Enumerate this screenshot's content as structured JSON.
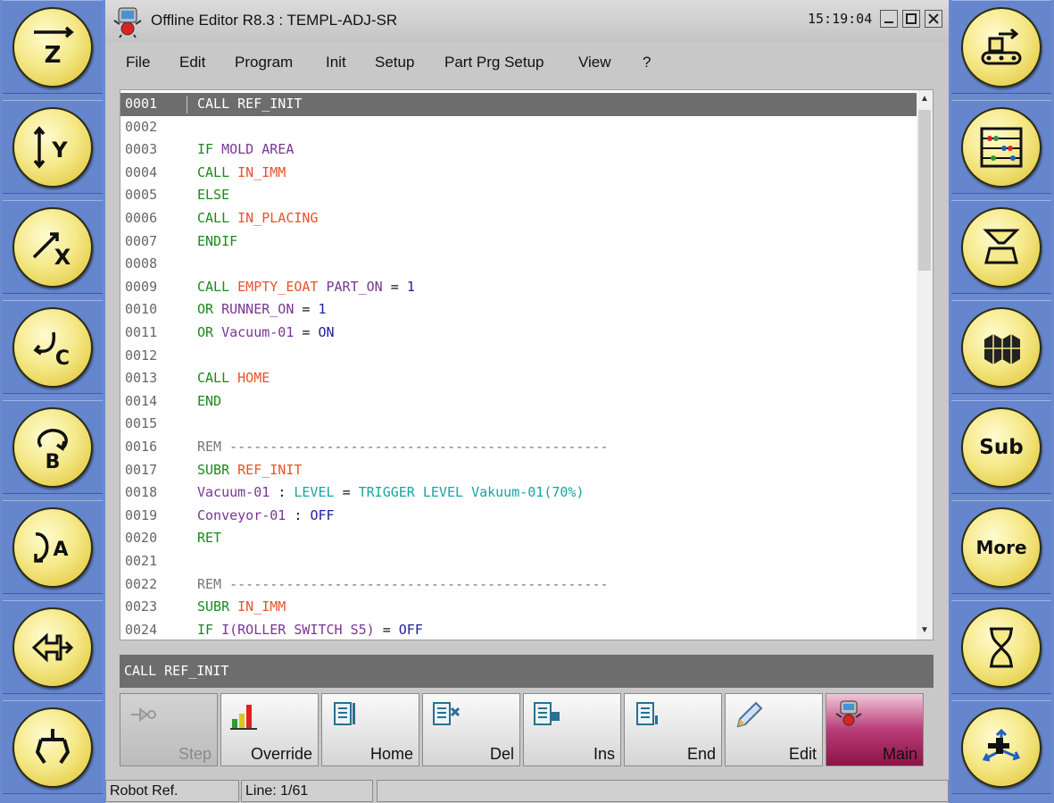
{
  "window": {
    "title": "Offline Editor R8.3 : TEMPL-ADJ-SR",
    "clock": "15:19:04"
  },
  "menu": [
    "File",
    "Edit",
    "Program",
    "Init",
    "Setup",
    "Part Prg Setup",
    "View",
    "?"
  ],
  "left_buttons": [
    {
      "icon": "z-axis-icon",
      "glyph": "Z"
    },
    {
      "icon": "y-axis-icon",
      "glyph": "Y"
    },
    {
      "icon": "x-axis-icon",
      "glyph": "X"
    },
    {
      "icon": "c-rotation-icon",
      "glyph": "C"
    },
    {
      "icon": "b-rotation-icon",
      "glyph": "B"
    },
    {
      "icon": "a-rotation-icon",
      "glyph": "A"
    },
    {
      "icon": "move-in-out-icon",
      "glyph": ""
    },
    {
      "icon": "gripper-icon",
      "glyph": ""
    }
  ],
  "right_buttons": [
    {
      "icon": "conveyor-icon",
      "label": ""
    },
    {
      "icon": "counter-abacus-icon",
      "label": ""
    },
    {
      "icon": "mold-icon",
      "label": ""
    },
    {
      "icon": "cubes-icon",
      "label": ""
    },
    {
      "icon": "",
      "label": "Sub"
    },
    {
      "icon": "",
      "label": "More"
    },
    {
      "icon": "hourglass-icon",
      "label": ""
    },
    {
      "icon": "axes-coordinate-icon",
      "label": ""
    }
  ],
  "code_lines": [
    {
      "ln": "0001",
      "code": "CALL REF_INIT",
      "selected": true
    },
    {
      "ln": "0002",
      "code": ""
    },
    {
      "ln": "0003",
      "code": "IF MOLD AREA"
    },
    {
      "ln": "0004",
      "code": "CALL IN_IMM"
    },
    {
      "ln": "0005",
      "code": "ELSE"
    },
    {
      "ln": "0006",
      "code": "CALL IN_PLACING"
    },
    {
      "ln": "0007",
      "code": "ENDIF"
    },
    {
      "ln": "0008",
      "code": ""
    },
    {
      "ln": "0009",
      "code": "CALL EMPTY_EOAT PART_ON = 1"
    },
    {
      "ln": "0010",
      "code": "OR RUNNER_ON = 1"
    },
    {
      "ln": "0011",
      "code": "OR Vacuum-01 = ON"
    },
    {
      "ln": "0012",
      "code": ""
    },
    {
      "ln": "0013",
      "code": "CALL HOME"
    },
    {
      "ln": "0014",
      "code": "END"
    },
    {
      "ln": "0015",
      "code": ""
    },
    {
      "ln": "0016",
      "code": "REM -----------------------------------------------"
    },
    {
      "ln": "0017",
      "code": "SUBR REF_INIT"
    },
    {
      "ln": "0018",
      "code": "Vacuum-01 : LEVEL = TRIGGER LEVEL Vakuum-01(70%)"
    },
    {
      "ln": "0019",
      "code": "Conveyor-01 : OFF"
    },
    {
      "ln": "0020",
      "code": "RET"
    },
    {
      "ln": "0021",
      "code": ""
    },
    {
      "ln": "0022",
      "code": "REM -----------------------------------------------"
    },
    {
      "ln": "0023",
      "code": "SUBR IN_IMM"
    },
    {
      "ln": "0024",
      "code": "IF I(ROLLER SWITCH S5) = OFF"
    }
  ],
  "command_line": "CALL REF_INIT",
  "toolbar": [
    {
      "label": "Step",
      "icon": "step-icon",
      "disabled": true
    },
    {
      "label": "Override",
      "icon": "override-bars-icon"
    },
    {
      "label": "Home",
      "icon": "home-doc-icon"
    },
    {
      "label": "Del",
      "icon": "delete-doc-icon"
    },
    {
      "label": "Ins",
      "icon": "insert-doc-icon"
    },
    {
      "label": "End",
      "icon": "end-doc-icon"
    },
    {
      "label": "Edit",
      "icon": "pencil-icon"
    },
    {
      "label": "Main",
      "icon": "robot-icon",
      "active": true
    }
  ],
  "status": {
    "mode": "Robot Ref.",
    "line": "Line: 1/61"
  },
  "colors": {
    "keyword": "#1a8a1a",
    "identifier": "#e8522a",
    "variable": "#7a3596",
    "number": "#2020a0",
    "trigger": "#16a5a0",
    "selection": "#6d6d6d",
    "side_panel": "#6585cc",
    "button_yellow": "#f5e98a",
    "main_button": "#8e1446"
  }
}
